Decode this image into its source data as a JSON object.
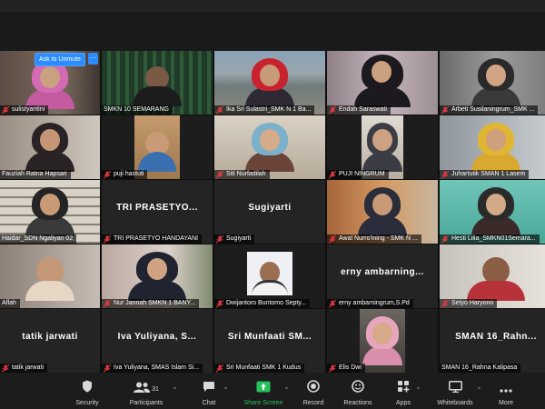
{
  "meeting": {
    "ask_to_unmute": "Ask to Unmute",
    "more": "···"
  },
  "tiles": [
    {
      "label": "sulistyantini"
    },
    {
      "label": "SMKN 10 SEMARANG"
    },
    {
      "label": "Ika Sri Sulastri_SMK N 1 Ba..."
    },
    {
      "label": "Endah Saraswati"
    },
    {
      "label": "Arbeti Susilaningrum_SMK ..."
    },
    {
      "label": "Fauziah Ratna Hapsari"
    },
    {
      "label": "puji hastuti"
    },
    {
      "label": "Siti Nurfadilah"
    },
    {
      "label": "PUJI NINGRUM"
    },
    {
      "label": "Juhartutik SMAN 1 Lasem"
    },
    {
      "label": "Haidar_SDN Ngaliyan 02"
    },
    {
      "label": "TRI PRASETYO HANDAYANI",
      "big": "TRI PRASETYO..."
    },
    {
      "label": "Sugiyarti",
      "big": "Sugiyarti"
    },
    {
      "label": "Awal Nurro'ining - SMK N ..."
    },
    {
      "label": "Hesti Lilia_SMKN01Semara..."
    },
    {
      "label": "Aflah"
    },
    {
      "label": "Nur Jannah SMKN 1 BANY..."
    },
    {
      "label": "Dwijantoro Buntomo Septy..."
    },
    {
      "label": "erny ambarningrum,S.Pd",
      "big": "erny ambarning..."
    },
    {
      "label": "Setyo Haryono"
    },
    {
      "label": "tatik jarwati",
      "big": "tatik jarwati"
    },
    {
      "label": "Iva Yuliyana, SMAS Islam Si...",
      "big": "Iva Yuliyana, S..."
    },
    {
      "label": "Sri Munfaati SMK 1 Kudus",
      "big": "Sri Munfaati SM..."
    },
    {
      "label": "Elis Dwi"
    },
    {
      "label": "SMAN 16_Rahna Kalipasa",
      "big": "SMAN 16_Rahn..."
    }
  ],
  "toolbar": {
    "security": "Security",
    "participants": "Participants",
    "participants_count": "31",
    "chat": "Chat",
    "share_screen": "Share Screen",
    "record": "Record",
    "reactions": "Reactions",
    "apps": "Apps",
    "whiteboards": "Whiteboards",
    "more": "More"
  },
  "colors": {
    "accent_blue": "#2d8cff",
    "share_green": "#27c15c",
    "active_speaker": "#e6e14a",
    "muted_red": "#e0393e"
  }
}
